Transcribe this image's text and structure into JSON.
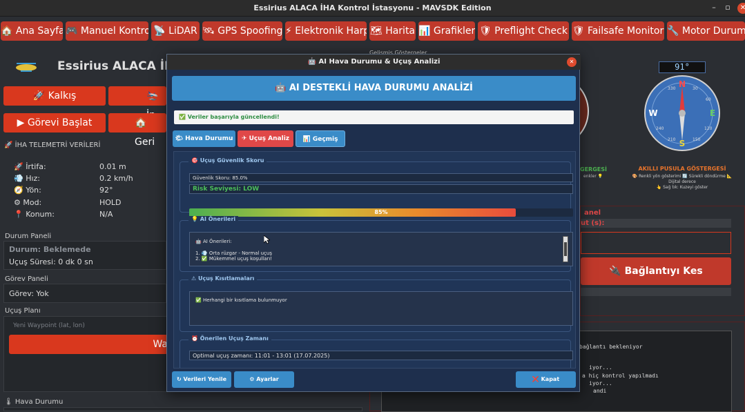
{
  "window": {
    "title": "Essirius ALACA İHA Kontrol İstasyonu - MAVSDK Edition",
    "minimize": "–",
    "maximize": "▫",
    "close": "✕"
  },
  "nav": [
    {
      "label": "🏠 Ana Sayfa"
    },
    {
      "label": "🎮 Manuel Kontrol"
    },
    {
      "label": "📡 LiDAR"
    },
    {
      "label": "🛰 GPS Spoofing"
    },
    {
      "label": "⚡ Elektronik Harp"
    },
    {
      "label": "🗺 Harita"
    },
    {
      "label": "📊 Grafikler"
    },
    {
      "label": "🛡 Preflight Check"
    },
    {
      "label": "🛡 Failsafe Monitor"
    },
    {
      "label": "🔧 Motor Durumu"
    }
  ],
  "left": {
    "app_name": "Essirius ALACA İHA",
    "takeoff": "🚀 Kalkış",
    "land_partial": "🛬 İn",
    "start_mission": "▶ Görevi Başlat",
    "return_partial": "🏠 Geri",
    "telemetry_title": "🚀 İHA TELEMETRİ VERİLERİ",
    "telemetry": [
      {
        "label": "🚀 İrtifa:",
        "value": "0.01 m"
      },
      {
        "label": "💨 Hız:",
        "value": "0.2 km/h"
      },
      {
        "label": "🧭 Yön:",
        "value": "92°"
      },
      {
        "label": "⚙ Mod:",
        "value": "HOLD"
      },
      {
        "label": "📍 Konum:",
        "value": "N/A"
      }
    ],
    "status_panel_title": "Durum Paneli",
    "status_text": "Durum: Beklemede",
    "flight_time": "Uçuş Süresi: 0 dk 0 sn",
    "mission_panel_title": "Görev Paneli",
    "mission_text": "Görev: Yok",
    "flight_plan_title": "Uçuş Planı",
    "waypoint_placeholder": "Yeni Waypoint (lat, lon)",
    "waypoint_button_partial": "Wa",
    "weather_title": "🌡 Hava Durumu"
  },
  "right": {
    "advanced_title_partial": "Gelişmiş Göstergeler",
    "heading_readout": "91°",
    "compass_letters": {
      "n": "N",
      "e": "E",
      "s": "S",
      "w": "W"
    },
    "compass_ticks": [
      "330",
      "30",
      "60",
      "120",
      "150",
      "210",
      "240"
    ],
    "left_gauge_title_partial": "GERGESİ",
    "left_gauge_sub_partial": "enkler 💡",
    "compass_title": "AKILLI PUSULA GÖSTERGESİ",
    "compass_note1": "🎨 Renkli yön gösterimi 🔄 Sürekli döndürme 📐",
    "compass_note2": "Dijital derece",
    "compass_note3": "👆 Sağ tık: Kuzeyi göster",
    "panel_title_partial": "anel",
    "field_label_partial": "ut (s):",
    "disconnect": "🔌 Bağlantıyı Kes",
    "log_lines": [
      "bağlantı bekleniyor",
      "iyor...",
      "a hiç kontrol yapılmadı",
      "iyor...",
      "andi"
    ]
  },
  "modal": {
    "title": "🤖 AI Hava Durumu & Uçuş Analizi",
    "banner": "🤖 AI DESTEKLİ HAVA DURUMU ANALİZİ",
    "success": "✅ Veriler başarıyla güncellendi!",
    "tabs": [
      {
        "label": "🌤 Hava Durumu",
        "color": "#3a8cc8"
      },
      {
        "label": "✈ Uçuş Analiz",
        "color": "#e04848"
      },
      {
        "label": "📊 Geçmiş",
        "color": "#3a8cc8"
      }
    ],
    "safety": {
      "title": "🎯 Uçuş Güvenlik Skoru",
      "score_text": "Güvenlik Skoru: 85.0%",
      "risk_text": "Risk Seviyesi: LOW",
      "progress_label": "85%",
      "progress": 0.85
    },
    "ai": {
      "title": "💡 AI Önerileri",
      "header": "🤖 AI Önerileri:",
      "items": [
        "1. 💨 Orta rüzgar - Normal uçuş",
        "2. ✅ Mükemmel uçuş koşulları!"
      ]
    },
    "limits": {
      "title": "⚠ Uçuş Kısıtlamaları",
      "text": "✅ Herhangi bir kısıtlama bulunmuyor"
    },
    "time": {
      "title": "⏰ Önerilen Uçuş Zamanı",
      "text": "Optimal uçuş zamanı: 11:01 - 13:01 (17.07.2025)"
    },
    "buttons": {
      "refresh": "↻ Verileri Yenile",
      "settings": "⚙ Ayarlar",
      "close": "❌ Kapat"
    }
  },
  "colors": {
    "accent_red": "#c0392b",
    "accent_blue": "#3a8cc8",
    "success_green": "#2f8e43"
  }
}
